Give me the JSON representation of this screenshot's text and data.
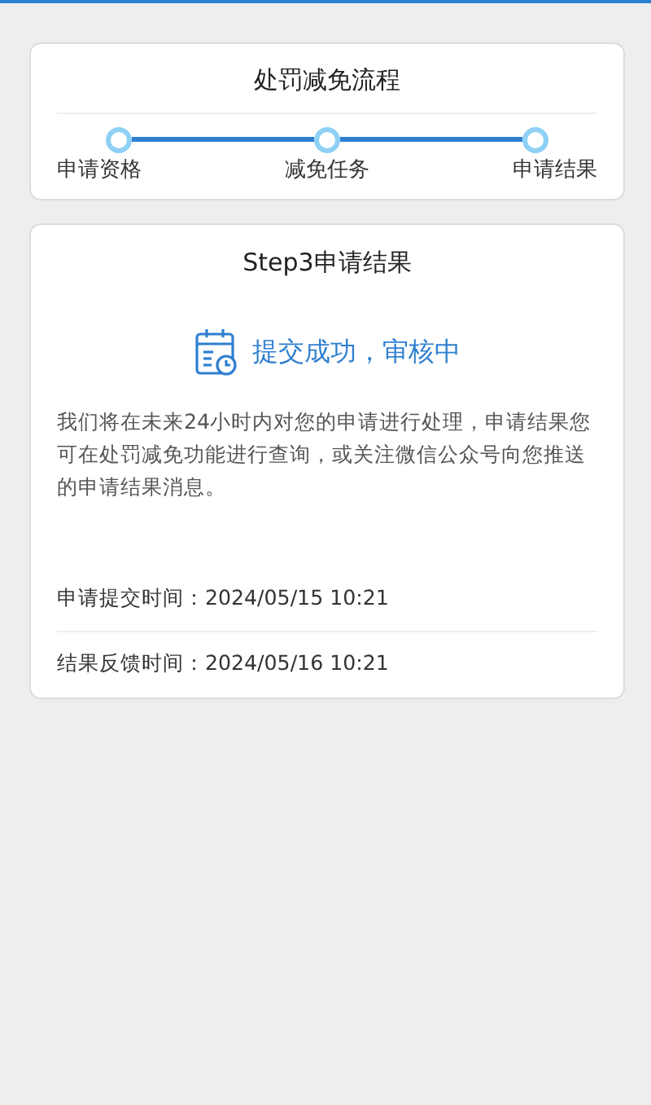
{
  "process_card": {
    "title": "处罚减免流程",
    "steps": [
      {
        "label": "申请资格"
      },
      {
        "label": "减免任务"
      },
      {
        "label": "申请结果"
      }
    ]
  },
  "result_card": {
    "title": "Step3申请结果",
    "status": "提交成功，审核中",
    "message": "我们将在未来24小时内对您的申请进行处理，申请结果您可在处罚减免功能进行查询，或关注微信公众号向您推送的申请结果消息。",
    "rows": [
      {
        "text": "申请提交时间：2024/05/15 10:21"
      },
      {
        "text": "结果反馈时间：2024/05/16 10:21"
      }
    ]
  }
}
